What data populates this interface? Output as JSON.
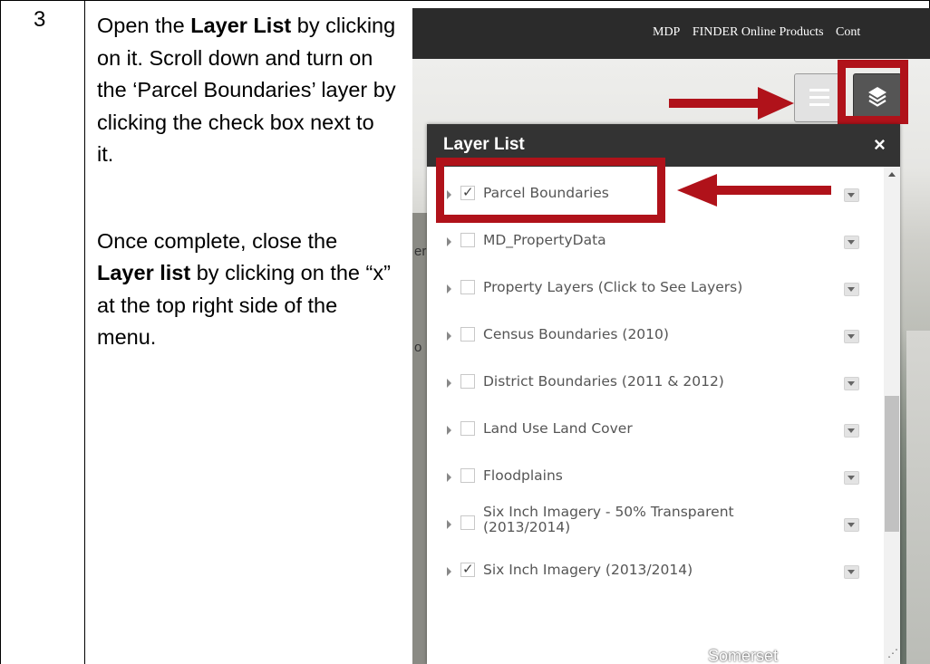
{
  "step": {
    "number": "3"
  },
  "instructions": {
    "p1_a": "Open the ",
    "p1_b": "Layer List",
    "p1_c": " by clicking on it. Scroll down and turn on the ‘Parcel Boundaries’ layer by clicking the check box next to it.",
    "p2_a": "Once complete, close the ",
    "p2_b": "Layer list",
    "p2_c": " by clicking on the “x” at the top right side of the menu."
  },
  "topbar": {
    "links": [
      "MDP",
      "FINDER Online Products",
      "Cont"
    ]
  },
  "panel": {
    "title": "Layer List",
    "close": "×",
    "layers": [
      {
        "label": "Parcel Boundaries",
        "checked": true
      },
      {
        "label": "MD_PropertyData",
        "checked": false
      },
      {
        "label": "Property Layers (Click to See Layers)",
        "checked": false
      },
      {
        "label": "Census Boundaries (2010)",
        "checked": false
      },
      {
        "label": "District Boundaries (2011 & 2012)",
        "checked": false
      },
      {
        "label": "Land Use Land Cover",
        "checked": false
      },
      {
        "label": "Floodplains",
        "checked": false
      },
      {
        "label": "Six Inch Imagery - 50% Transparent (2013/2014)",
        "checked": false
      },
      {
        "label": "Six Inch Imagery (2013/2014)",
        "checked": true
      }
    ]
  },
  "map": {
    "place_label": "Somerset",
    "side_label_1": "er",
    "side_label_2": "o"
  },
  "colors": {
    "highlight": "#b0121a",
    "topbar": "#2b2b2b",
    "panel_header": "#333333"
  },
  "icons": {
    "legend_button": "legend-list-icon",
    "layers_button": "layers-stack-icon"
  }
}
